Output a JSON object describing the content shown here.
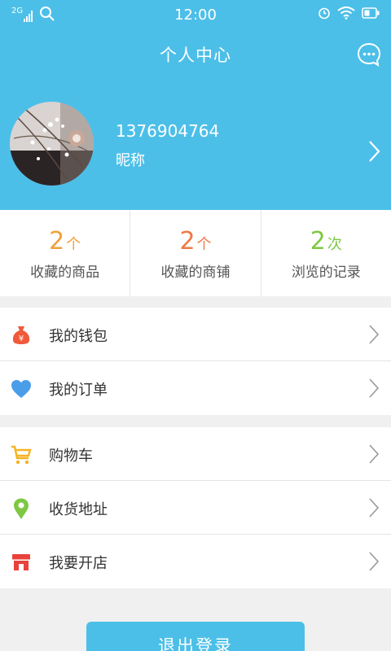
{
  "status_bar": {
    "network": "2G",
    "time": "12:00"
  },
  "header": {
    "title": "个人中心",
    "message_icon": "chat-bubble-icon"
  },
  "profile": {
    "phone": "1376904764",
    "nickname": "昵称"
  },
  "stats": [
    {
      "value": "2",
      "unit": "个",
      "label": "收藏的商品",
      "color": "#f0a03a"
    },
    {
      "value": "2",
      "unit": "个",
      "label": "收藏的商铺",
      "color": "#ee7a45"
    },
    {
      "value": "2",
      "unit": "次",
      "label": "浏览的记录",
      "color": "#7ec843"
    }
  ],
  "menu_groups": [
    [
      {
        "label": "我的钱包",
        "icon": "money-bag-icon",
        "color": "#f05a3a"
      },
      {
        "label": "我的订单",
        "icon": "heart-icon",
        "color": "#4a9de8"
      }
    ],
    [
      {
        "label": "购物车",
        "icon": "cart-icon",
        "color": "#f5b324"
      },
      {
        "label": "收货地址",
        "icon": "location-pin-icon",
        "color": "#7ec843"
      },
      {
        "label": "我要开店",
        "icon": "shop-icon",
        "color": "#e8423a"
      }
    ]
  ],
  "logout_label": "退出登录",
  "accent_color": "#4cbfe8"
}
